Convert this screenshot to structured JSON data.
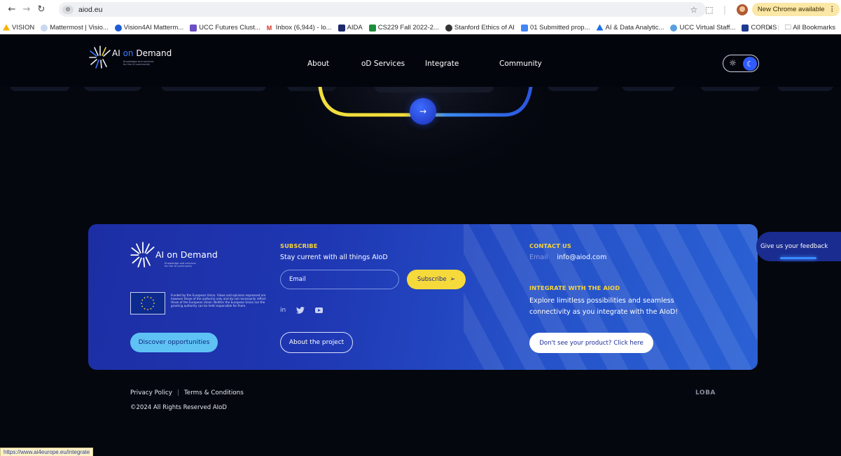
{
  "browser": {
    "url": "aiod.eu",
    "site_icon": "tune-icon",
    "update_label": "New Chrome available",
    "bookmarks": [
      {
        "label": "VISION",
        "color": "#1a73e8"
      },
      {
        "label": "Mattermost | Visio...",
        "color": "#7aa2d6"
      },
      {
        "label": "Vision4AI Matterm...",
        "color": "#1e5bd6"
      },
      {
        "label": "UCC Futures Clust...",
        "color": "#6b4fc4"
      },
      {
        "label": "Inbox (6,944) - lo...",
        "color": "#d93025"
      },
      {
        "label": "AIDA",
        "color": "#1d2a6b"
      },
      {
        "label": "CS229 Fall 2022-2...",
        "color": "#1e8e3e"
      },
      {
        "label": "Stanford Ethics of AI",
        "color": "#333333"
      },
      {
        "label": "01 Submitted prop...",
        "color": "#4285f4"
      },
      {
        "label": "AI & Data Analytic...",
        "color": "#1a73e8"
      },
      {
        "label": "UCC Virtual Staff...",
        "color": "#5aa0e0"
      },
      {
        "label": "CORDIS",
        "color": "#1f3a93"
      }
    ],
    "more_label": "»",
    "all_bookmarks": "All Bookmarks",
    "status_url": "https://www.ai4europe.eu/integrate"
  },
  "site": {
    "logo": {
      "ai": "AI",
      "on": "on",
      "demand": "Demand",
      "tagline": "Knowledge and services for the AI community"
    },
    "nav": [
      "About",
      "oD Services",
      "Integrate",
      "Community"
    ]
  },
  "footer_card": {
    "logo": {
      "ai": "AI",
      "on": "on",
      "demand": "Demand",
      "tagline": "Knowledge and services for the AI community"
    },
    "eu_disclaimer": "Funded by the European Union. Views and opinions expressed are however those of the author(s) only and do not necessarily reflect those of the European Union. Neither the European Union nor the granting authority can be held responsible for them.",
    "discover_label": "Discover opportunities",
    "subscribe_title": "SUBSCRIBE",
    "subscribe_line": "Stay current with all things AIoD",
    "email_placeholder": "Email",
    "subscribe_button": "Subscribe",
    "socials": [
      "in"
    ],
    "about_label": "About the project",
    "contact_title": "CONTACT US",
    "contact_label": "Email",
    "contact_email": "info@aiod.com",
    "integrate_title": "INTEGRATE WITH THE AIOD",
    "integrate_text": "Explore limitless possibilities and seamless connectivity as you integrate with the AIoD!",
    "product_label": "Don't see your product? Click here"
  },
  "feedback_label": "Give us your feedback",
  "bottom": {
    "privacy": "Privacy Policy",
    "separator": "|",
    "terms": "Terms & Conditions",
    "copyright": "©2024 All Rights Reserved AIoD",
    "agency": "LOBA"
  },
  "colors": {
    "accent_yellow": "#f6d93b",
    "accent_blue": "#2f5bff",
    "card_blue": "#1f37b3"
  }
}
